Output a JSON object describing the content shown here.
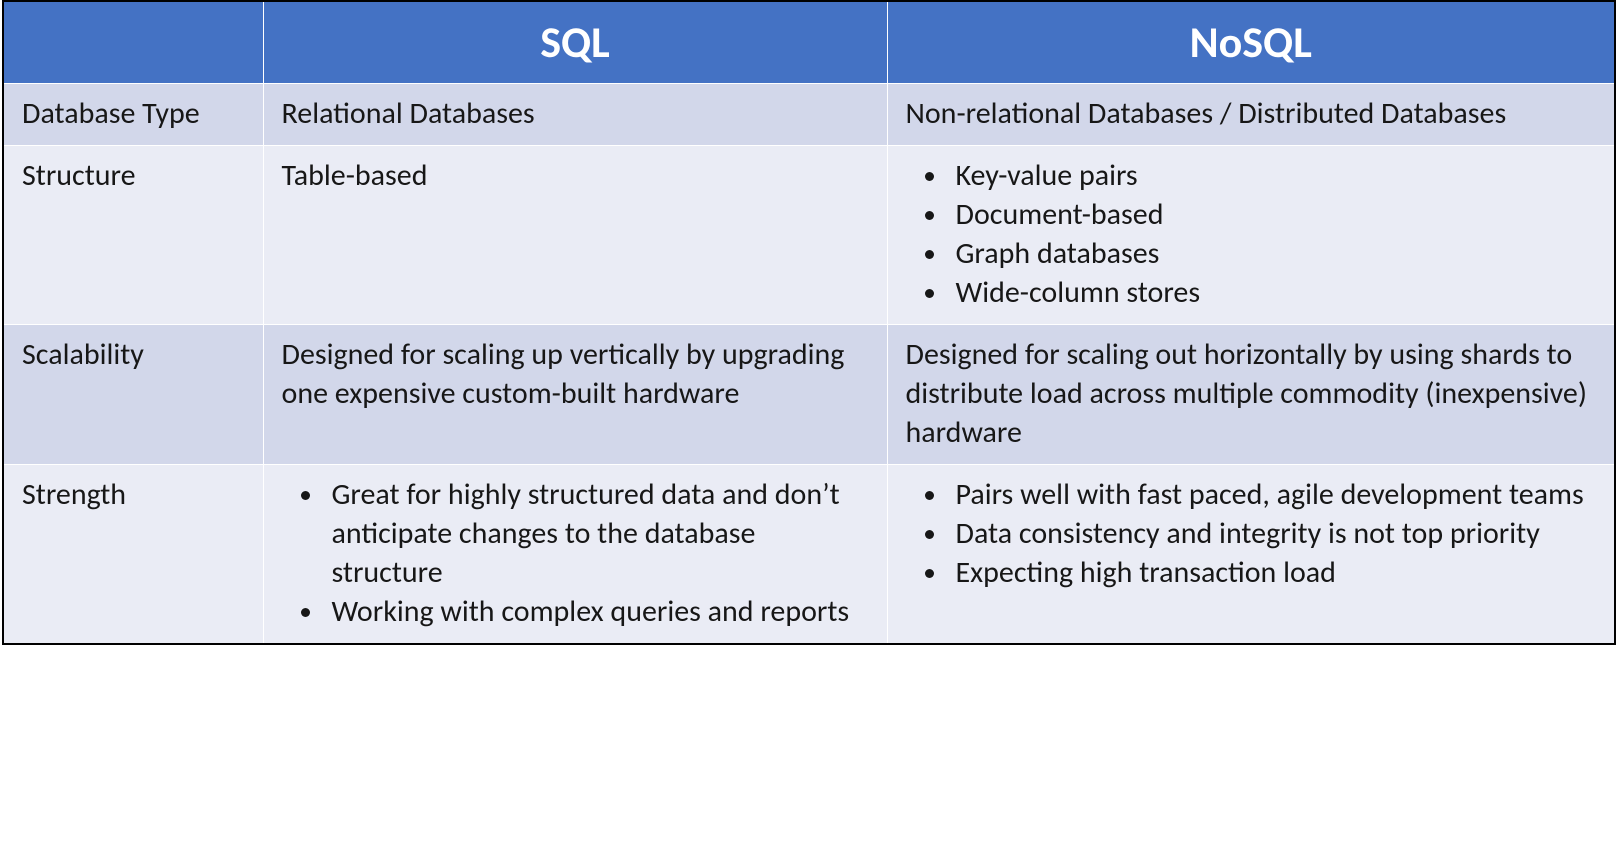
{
  "chart_data": {
    "type": "table",
    "columns": [
      "",
      "SQL",
      "NoSQL"
    ],
    "rows": [
      {
        "label": "Database Type",
        "sql": "Relational Databases",
        "nosql": "Non-relational Databases / Distributed Databases"
      },
      {
        "label": "Structure",
        "sql": "Table-based",
        "nosql": [
          "Key-value pairs",
          "Document-based",
          "Graph databases",
          "Wide-column stores"
        ]
      },
      {
        "label": "Scalability",
        "sql": "Designed for scaling up vertically by upgrading one expensive custom-built hardware",
        "nosql": "Designed for scaling out horizontally by using shards to distribute load across multiple commodity (inexpensive) hardware"
      },
      {
        "label": "Strength",
        "sql": [
          "Great for highly structured data and don’t anticipate changes to the database structure",
          "Working with complex queries and reports"
        ],
        "nosql": [
          "Pairs well with fast paced, agile development teams",
          "Data consistency and integrity is not top priority",
          "Expecting high transaction load"
        ]
      }
    ]
  },
  "header": {
    "corner": "",
    "col1": "SQL",
    "col2": "NoSQL"
  },
  "rows": {
    "r0": {
      "label": "Database Type",
      "sql_text": "Relational Databases",
      "nosql_text": "Non-relational Databases / Distributed Databases"
    },
    "r1": {
      "label": "Structure",
      "sql_text": "Table-based",
      "nosql_items": {
        "i0": "Key-value pairs",
        "i1": "Document-based",
        "i2": "Graph databases",
        "i3": "Wide-column stores"
      }
    },
    "r2": {
      "label": "Scalability",
      "sql_text": "Designed for scaling up vertically by upgrading one expensive custom-built hardware",
      "nosql_text": "Designed for scaling out horizontally by using shards to distribute load across multiple commodity (inexpensive) hardware"
    },
    "r3": {
      "label": "Strength",
      "sql_items": {
        "i0": "Great for highly structured data and don’t anticipate changes to the database structure",
        "i1": "Working with complex queries and reports"
      },
      "nosql_items": {
        "i0": "Pairs well with fast paced, agile development teams",
        "i1": "Data consistency and integrity is not top priority",
        "i2": "Expecting high transaction load"
      }
    }
  }
}
